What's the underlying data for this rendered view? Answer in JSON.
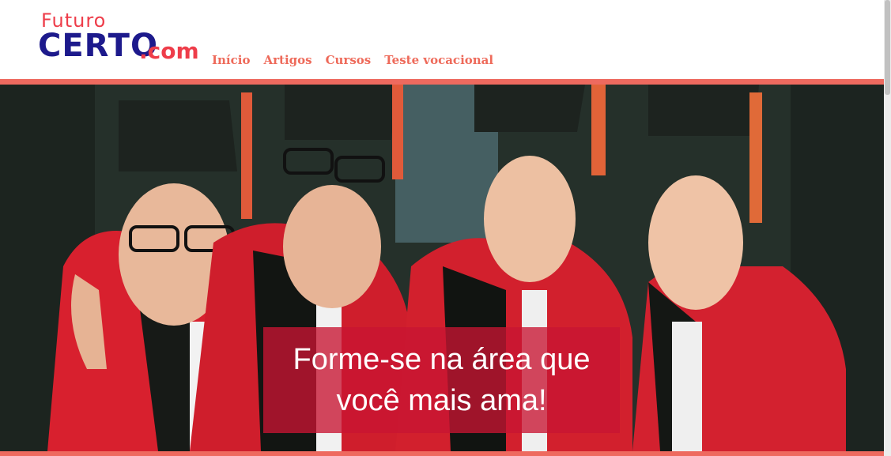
{
  "brand": {
    "logo_top": "Futuro",
    "logo_main": "CERTO",
    "logo_suffix": ".com"
  },
  "nav": {
    "items": [
      {
        "label": "Início"
      },
      {
        "label": "Artigos"
      },
      {
        "label": "Cursos"
      },
      {
        "label": "Teste vocacional"
      }
    ]
  },
  "hero": {
    "image_description": "Quatro formandos sorridentes com becas vermelhas e capelos pretos",
    "caption": "Forme-se na área que você mais ama!"
  },
  "colors": {
    "accent": "#ee6a5f",
    "logo_red": "#ee3d4a",
    "logo_blue": "#1d1a8c",
    "caption_bg": "#c8143280"
  }
}
